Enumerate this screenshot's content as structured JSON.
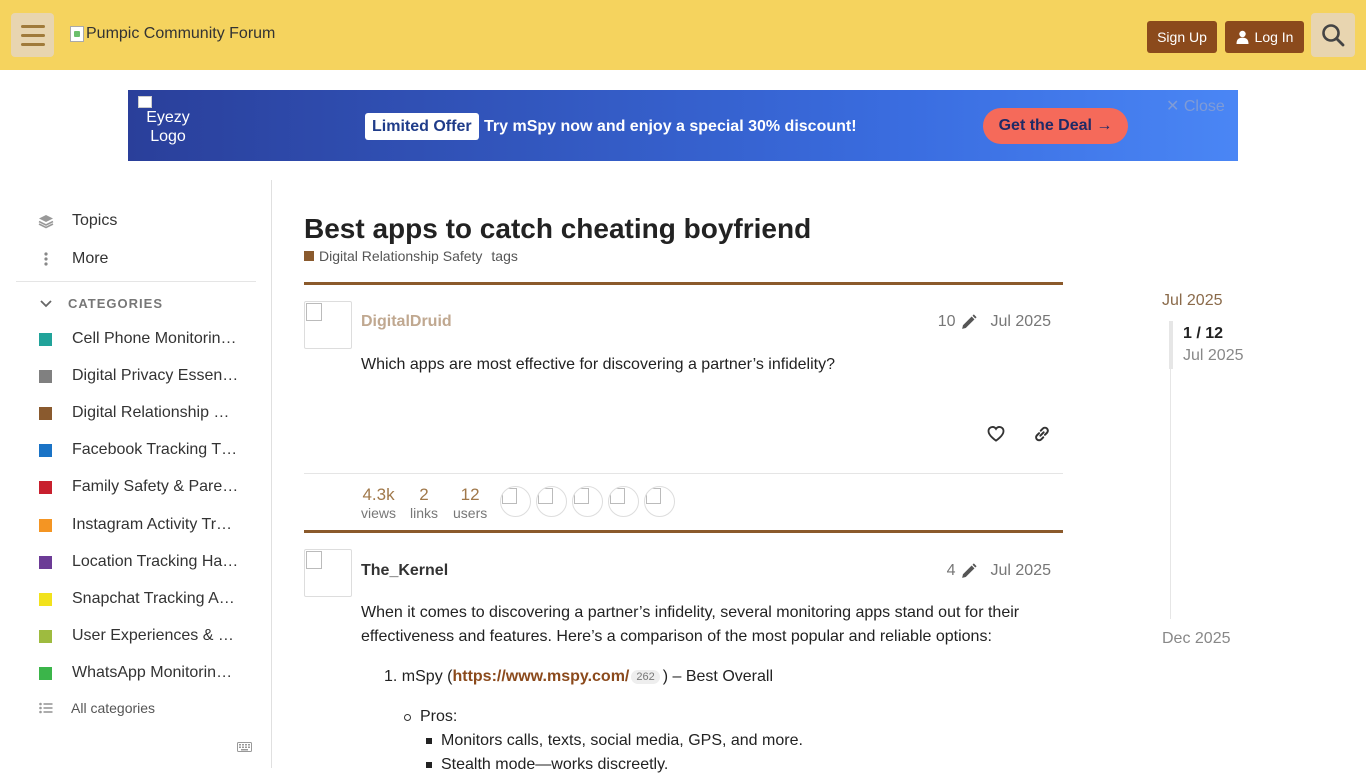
{
  "header": {
    "logo_alt": "Pumpic Community Forum",
    "signup_label": "Sign Up",
    "login_label": "Log In"
  },
  "banner": {
    "logo_alt": "Eyezy Logo",
    "badge": "Limited Offer",
    "text": "Try mSpy now and enjoy a special 30% discount!",
    "cta": "Get the Deal →",
    "close": "Close"
  },
  "sidebar": {
    "topics": "Topics",
    "more": "More",
    "categories_heading": "CATEGORIES",
    "categories": [
      {
        "label": "Cell Phone Monitorin…",
        "color": "#21a39a"
      },
      {
        "label": "Digital Privacy Essen…",
        "color": "#808080"
      },
      {
        "label": "Digital Relationship …",
        "color": "#8a5a2e"
      },
      {
        "label": "Facebook Tracking T…",
        "color": "#1a73c6"
      },
      {
        "label": "Family Safety & Pare…",
        "color": "#c8202e"
      },
      {
        "label": "Instagram Activity Tr…",
        "color": "#f49523"
      },
      {
        "label": "Location Tracking Ha…",
        "color": "#6c3b96"
      },
      {
        "label": "Snapchat Tracking A…",
        "color": "#f2e21c"
      },
      {
        "label": "User Experiences & …",
        "color": "#9ebb3f"
      },
      {
        "label": "WhatsApp Monitorin…",
        "color": "#3bb54a"
      }
    ],
    "all_categories": "All categories"
  },
  "topic": {
    "title": "Best apps to catch cheating boyfriend",
    "category": "Digital Relationship Safety",
    "tags": "tags"
  },
  "posts": [
    {
      "username": "DigitalDruid",
      "edits": "10",
      "date": "Jul 2025",
      "body": "Which apps are most effective for discovering a partner’s infidelity?"
    },
    {
      "username": "The_Kernel",
      "edits": "4",
      "date": "Jul 2025",
      "body_line1": "When it comes to discovering a partner’s infidelity, several monitoring apps stand out for their",
      "body_line2": "effectiveness and features. Here’s a comparison of the most popular and reliable options:",
      "list_item1_prefix": "1. mSpy (",
      "list_item1_link": "https://www.mspy.com/",
      "list_item1_clicks": "262",
      "list_item1_suffix": ") – Best Overall",
      "pros_label": "Pros:",
      "pro1": "Monitors calls, texts, social media, GPS, and more.",
      "pro2": "Stealth mode—works discreetly."
    }
  ],
  "topic_map": {
    "views": "4.3k",
    "views_label": "views",
    "links": "2",
    "links_label": "links",
    "users": "12",
    "users_label": "users"
  },
  "timeline": {
    "start": "Jul 2025",
    "position": "1 / 12",
    "current_date": "Jul 2025",
    "end": "Dec 2025"
  }
}
